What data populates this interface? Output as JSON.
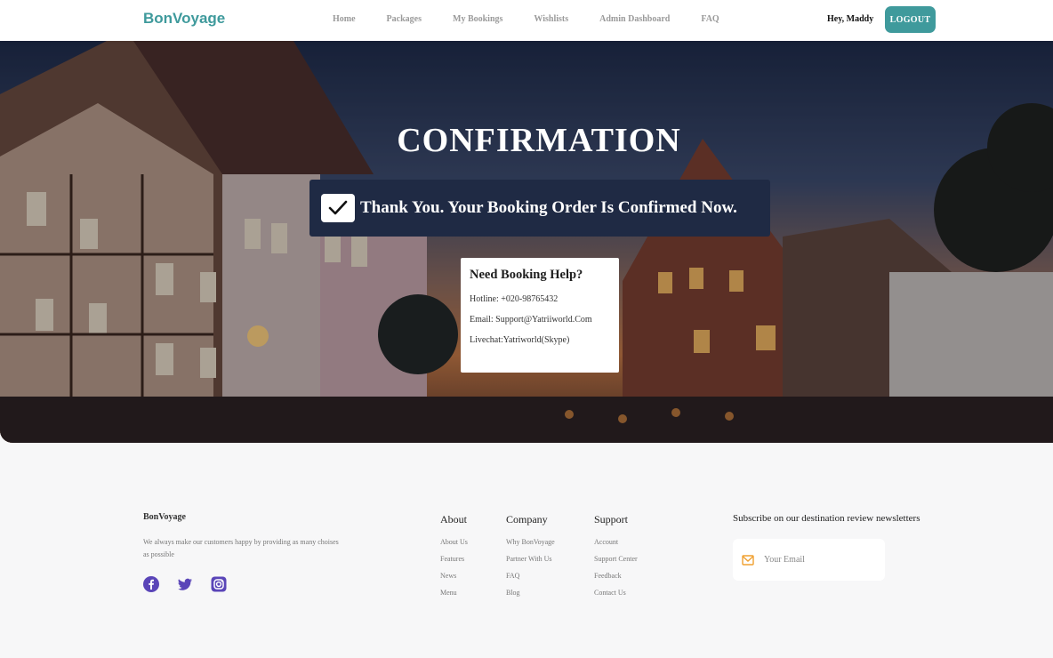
{
  "nav": {
    "brand": "BonVoyage",
    "links": [
      "Home",
      "Packages",
      "My Bookings",
      "Wishlists",
      "Admin Dashboard",
      "FAQ"
    ],
    "greeting": "Hey, Maddy",
    "logout": "LOGOUT"
  },
  "hero": {
    "title": "CONFIRMATION",
    "confirm_message": "Thank You. Your Booking Order Is Confirmed Now.",
    "help": {
      "title": "Need Booking Help?",
      "hotline": "Hotline: +020-98765432",
      "email": "Email: Support@Yatriiworld.Com",
      "livechat": "Livechat:Yatriworld(Skype)"
    }
  },
  "footer": {
    "brand": "BonVoyage",
    "description": "We always make our customers happy by providing as many choises as possible",
    "socials": [
      "facebook-icon",
      "twitter-icon",
      "instagram-icon"
    ],
    "columns": [
      {
        "title": "About",
        "items": [
          "About Us",
          "Features",
          "News",
          "Menu"
        ]
      },
      {
        "title": "Company",
        "items": [
          "Why BonVoyage",
          "Partner With Us",
          "FAQ",
          "Blog"
        ]
      },
      {
        "title": "Support",
        "items": [
          "Account",
          "Support Center",
          "Feedback",
          "Contact Us"
        ]
      }
    ],
    "newsletter": {
      "title": "Subscribe on our destination review newsletters",
      "placeholder": "Your Email"
    }
  },
  "colors": {
    "accent": "#3f9a9c",
    "confirm_bar": "#1f2a44",
    "social": "#5a45b8",
    "mail_icon": "#f0a030"
  }
}
